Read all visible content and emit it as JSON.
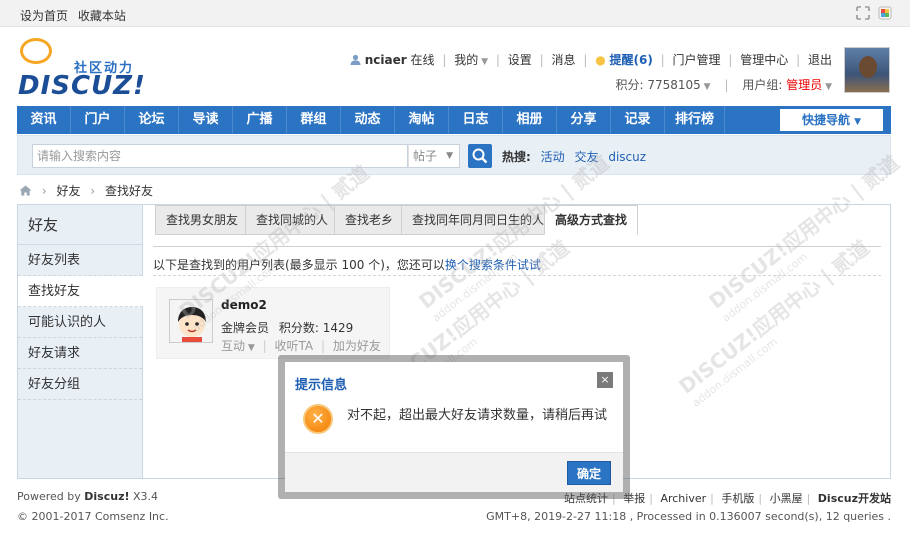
{
  "topbar": {
    "set_home": "设为首页",
    "bookmark": "收藏本站"
  },
  "logo": {
    "tagline": "社区动力",
    "wordmark": "DISCUZ!"
  },
  "user": {
    "name": "nciaer",
    "online": "在线",
    "mine": "我的",
    "settings": "设置",
    "messages": "消息",
    "reminders": "提醒(6)",
    "portal_admin": "门户管理",
    "admin_center": "管理中心",
    "logout": "退出",
    "points": "积分: 7758105",
    "group_label": "用户组:",
    "group_value": "管理员"
  },
  "nav": {
    "items": [
      "资讯",
      "门户",
      "论坛",
      "导读",
      "广播",
      "群组",
      "动态",
      "淘帖",
      "日志",
      "相册",
      "分享",
      "记录",
      "排行榜"
    ],
    "quick": "快捷导航"
  },
  "search": {
    "placeholder": "请输入搜索内容",
    "type": "帖子",
    "hot_label": "热搜:",
    "hot_terms": [
      "活动",
      "交友",
      "discuz"
    ]
  },
  "breadcrumb": {
    "items": [
      "好友",
      "查找好友"
    ]
  },
  "sidebar": {
    "title": "好友",
    "items": [
      "好友列表",
      "查找好友",
      "可能认识的人",
      "好友请求",
      "好友分组"
    ]
  },
  "tabs": [
    "查找男女朋友",
    "查找同城的人",
    "查找老乡",
    "查找同年同月同日生的人",
    "高级方式查找"
  ],
  "result_note": {
    "text": "以下是查找到的用户列表(最多显示 100 个)，您还可以",
    "link": "换个搜索条件试试"
  },
  "result_card": {
    "name": "demo2",
    "rank": "金牌会员",
    "points": "积分数: 1429",
    "action_interact": "互动",
    "action_follow": "收听TA",
    "action_add": "加为好友"
  },
  "dialog": {
    "title": "提示信息",
    "close": "×",
    "message": "对不起，超出最大好友请求数量，请稍后再试",
    "confirm": "确定"
  },
  "footer": {
    "powered_prefix": "Powered by",
    "powered_name": "Discuz!",
    "version": "X3.4",
    "copyright": "© 2001-2017 Comsenz Inc.",
    "links": [
      "站点统计",
      "举报",
      "Archiver",
      "手机版",
      "小黑屋"
    ],
    "dev_site": "Discuz开发站",
    "stats": "GMT+8, 2019-2-27 11:18 , Processed in 0.136007 second(s), 12 queries ."
  },
  "watermark": {
    "main": "DISCUZ!应用中心 | 贰道",
    "sub": "addon.dismall.com"
  },
  "colors": {
    "brand_blue": "#2b73c3",
    "link_blue": "#1f5fb3",
    "admin_red": "#ee0000",
    "warning_orange": "#f27a00"
  }
}
